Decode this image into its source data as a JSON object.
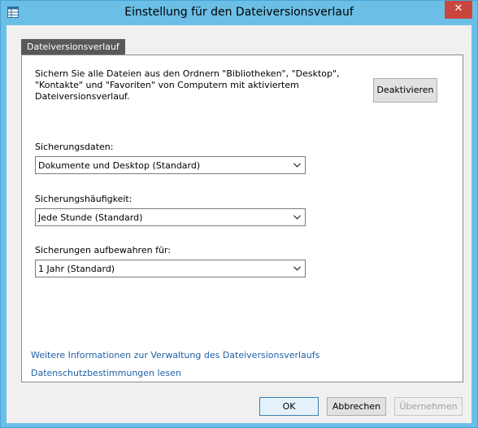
{
  "window": {
    "title": "Einstellung für den Dateiversionsverlauf",
    "close_symbol": "✕",
    "icon": "control-panel-icon"
  },
  "group": {
    "tab_label": "Dateiversionsverlauf",
    "description": "Sichern Sie alle Dateien aus den Ordnern \"Bibliotheken\", \"Desktop\", \"Kontakte\" und \"Favoriten\" von Computern mit aktiviertem Dateiversionsverlauf.",
    "deactivate_label": "Deaktivieren"
  },
  "settings": {
    "data_label": "Sicherungsdaten:",
    "data_value": "Dokumente und Desktop (Standard)",
    "frequency_label": "Sicherungshäufigkeit:",
    "frequency_value": "Jede Stunde (Standard)",
    "retention_label": "Sicherungen aufbewahren für:",
    "retention_value": "1 Jahr (Standard)"
  },
  "links": {
    "more_info": "Weitere Informationen zur Verwaltung des Dateiversionsverlaufs",
    "privacy": "Datenschutzbestimmungen lesen"
  },
  "footer": {
    "ok_label": "OK",
    "cancel_label": "Abbrechen",
    "apply_label": "Übernehmen"
  },
  "colors": {
    "titlebar": "#6bbfe6",
    "close_button": "#c9463d",
    "link": "#1f5fa8"
  }
}
